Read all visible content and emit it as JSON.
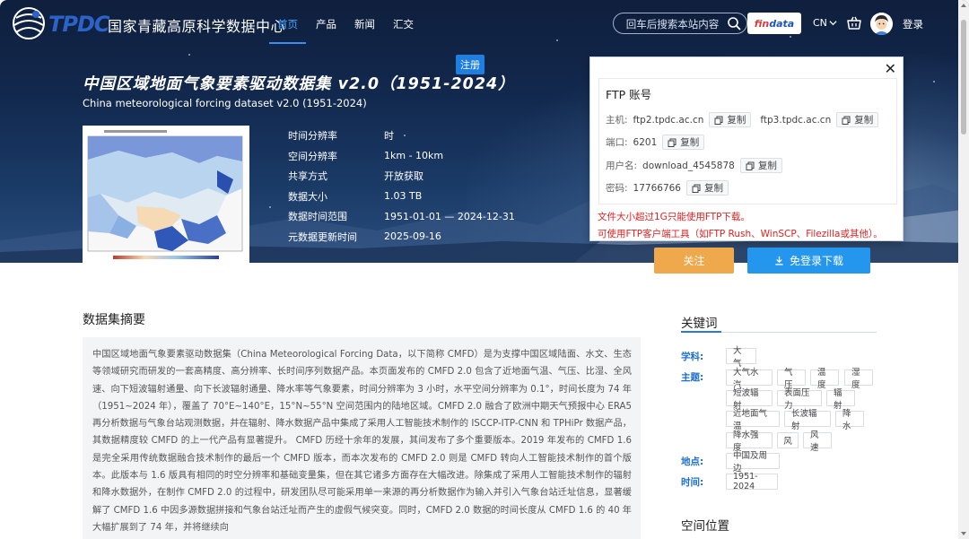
{
  "nav": {
    "logo_text": "TPDC",
    "site_name": "国家青藏高原科学数据中心",
    "links": [
      "首页",
      "产品",
      "新闻",
      "汇交"
    ],
    "active_link": "首页",
    "search_placeholder": "回车后搜索本站内容",
    "findata_a": "fin",
    "findata_b": "data",
    "lang": "CN",
    "login": "登录"
  },
  "hero": {
    "register_badge": "注册",
    "title": "中国区域地面气象要素驱动数据集 v2.0（1951-2024）",
    "subtitle": "China meteorological forcing dataset v2.0 (1951-2024)",
    "metadata": [
      {
        "key": "时间分辨率",
        "value": "时"
      },
      {
        "key": "空间分辨率",
        "value": "1km - 10km"
      },
      {
        "key": "共享方式",
        "value": "开放获取"
      },
      {
        "key": "数据大小",
        "value": "1.03 TB"
      },
      {
        "key": "数据时间范围",
        "value": "1951-01-01 — 2024-12-31"
      },
      {
        "key": "元数据更新时间",
        "value": "2025-09-16"
      }
    ]
  },
  "ftp": {
    "title": "FTP 账号",
    "host_label": "主机:",
    "host1": "ftp2.tpdc.ac.cn",
    "host2": "ftp3.tpdc.ac.cn",
    "port_label": "端口:",
    "port": "6201",
    "user_label": "用户名:",
    "user": "download_4545878",
    "pass_label": "密码:",
    "password": "17766766",
    "copy_label": "复制",
    "warning1": "文件大小超过1G只能使用FTP下载。",
    "warning2": "可使用FTP客户端工具（如FTP Rush、WinSCP、Filezilla或其他）。"
  },
  "actions": {
    "follow": "关注",
    "download": "免登录下载"
  },
  "abstract": {
    "title": "数据集摘要",
    "text": "中国区域地面气象要素驱动数据集（China Meteorological Forcing Data，以下简称 CMFD）是为支撑中国区域陆面、水文、生态等领域研究而研发的一套高精度、高分辨率、长时间序列数据产品。本页面发布的 CMFD 2.0 包含了近地面气温、气压、比湿、全风速、向下短波辐射通量、向下长波辐射通量、降水率等气象要素，时间分辨率为 3 小时，水平空间分辨率为 0.1°，时间长度为 74 年（1951~2024 年），覆盖了 70°E~140°E，15°N~55°N 空间范围内的陆地区域。CMFD 2.0 融合了欧洲中期天气预报中心 ERA5 再分析数据与气象台站观测数据，并在辐射、降水数据产品中集成了采用人工智能技术制作的 ISCCP-ITP-CNN 和 TPHiPr 数据产品，其数据精度较 CMFD 的上一代产品有显著提升。 CMFD 历经十余年的发展，其间发布了多个重要版本。2019 年发布的 CMFD 1.6 是完全采用传统数据融合技术制作的最后一个 CMFD 版本，而本次发布的 CMFD 2.0 则是 CMFD 转向人工智能技术制作的首个版本。此版本与 1.6 版具有相同的时空分辨率和基础变量集，但在其它诸多方面存在大幅改进。除集成了采用人工智能技术制作的辐射和降水数据外，在制作 CMFD 2.0 的过程中，研发团队尽可能采用单一来源的再分析数据作为输入并引入气象台站迁址信息，显著缓解了 CMFD 1.6 中因多源数据拼接和气象台站迁址而产生的虚假气候突变。同时，CMFD 2.0 数据的时间长度从 CMFD 1.6 的 40 年大幅扩展到了 74 年，并将继续向"
  },
  "keywords": {
    "title": "关键词",
    "subject_label": "学科:",
    "subject": [
      "大气"
    ],
    "theme_label": "主题:",
    "themes": [
      "大气水汽",
      "气压",
      "温度",
      "湿度",
      "短波辐射",
      "表面压力",
      "辐射",
      "近地面气温",
      "长波辐射",
      "降水",
      "降水强度",
      "风",
      "风速"
    ],
    "place_label": "地点:",
    "places": [
      "中国及周边"
    ],
    "time_label": "时间:",
    "times": [
      "1951-2024"
    ]
  },
  "spatial": {
    "title": "空间位置"
  },
  "colors": {
    "accent": "#2496ed",
    "follow": "#f0a84d",
    "warning": "#e02020",
    "keyword_label": "#1d6ed0"
  }
}
